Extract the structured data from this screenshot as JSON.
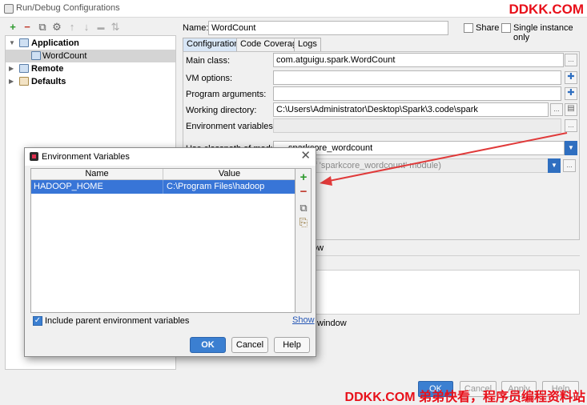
{
  "window": {
    "title": "Run/Debug Configurations"
  },
  "watermark": {
    "top": "DDKK.COM",
    "bottom": "DDKK.COM 弟弟快看，程序员编程资料站"
  },
  "toolbar": {
    "add": "+",
    "remove": "−",
    "copy": "⧉",
    "wrench": "⚙",
    "up": "↑",
    "down": "↓",
    "folder": "▬",
    "sort": "⇅"
  },
  "tree": {
    "items": [
      {
        "label": "Application",
        "expanded": "▼"
      },
      {
        "label": "WordCount"
      },
      {
        "label": "Remote",
        "expanded": "▶"
      },
      {
        "label": "Defaults",
        "expanded": "▶"
      }
    ]
  },
  "config": {
    "name_label": "Name:",
    "name_value": "WordCount",
    "share_label": "Share",
    "single_instance_label": "Single instance only",
    "tabs": [
      "Configuration",
      "Code Coverage",
      "Logs"
    ],
    "main_class_label": "Main class:",
    "main_class_value": "com.atguigu.spark.WordCount",
    "vm_options_label": "VM options:",
    "program_args_label": "Program arguments:",
    "working_dir_label": "Working directory:",
    "working_dir_value": "C:\\Users\\Administrator\\Desktop\\Spark\\3.code\\spark",
    "env_vars_label": "Environment variables:",
    "classpath_label": "Use classpath of module:",
    "classpath_value": "sparkcore_wordcount",
    "jre_value": "8 - SDK of 'sparkcore_wordcount' module)",
    "partial_show": "ow",
    "partial_window": "window",
    "ellipsis": "...",
    "combo_arrow": "▼"
  },
  "bottom_buttons": [
    "OK",
    "Cancel",
    "Apply",
    "Help"
  ],
  "dialog": {
    "title": "Environment Variables",
    "close": "✕",
    "columns": [
      "Name",
      "Value"
    ],
    "rows": [
      {
        "name": "HADOOP_HOME",
        "value": "C:\\Program Files\\hadoop"
      }
    ],
    "tools": {
      "add": "+",
      "remove": "−",
      "copy": "⧉",
      "paste": "⎘"
    },
    "include_parent_label": "Include parent environment variables",
    "include_parent_checked": "✓",
    "show_link": "Show",
    "ok": "OK",
    "cancel": "Cancel",
    "help": "Help"
  },
  "colors": {
    "accent": "#3b7fd1",
    "selection": "#3875d7",
    "watermark": "#e8101a",
    "arrow": "#e03a3a"
  }
}
